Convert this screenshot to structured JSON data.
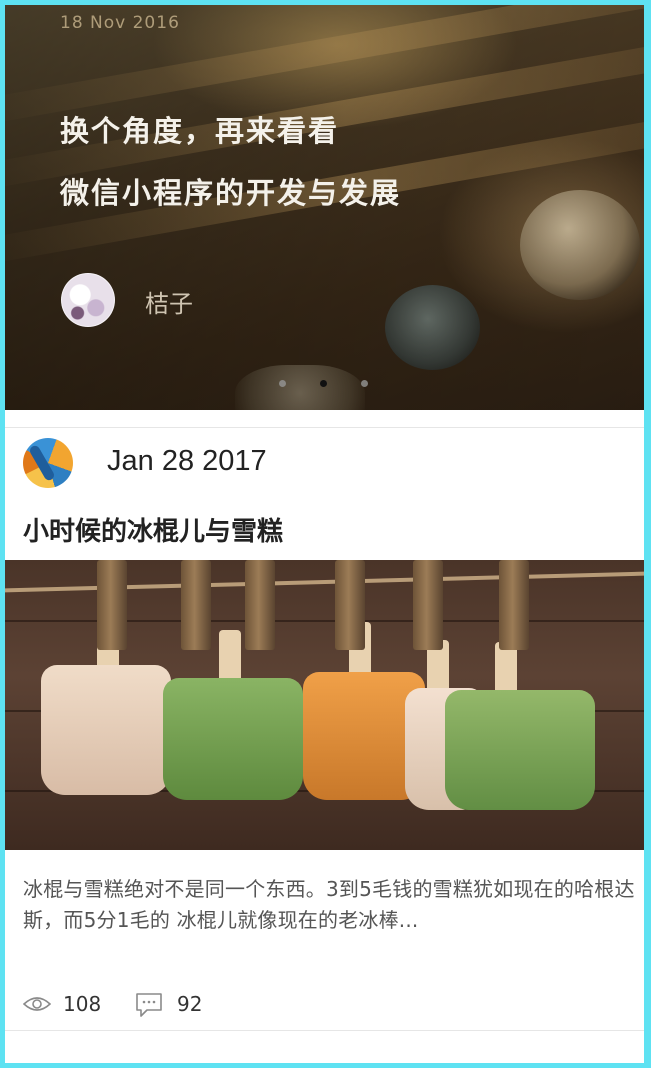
{
  "banner": {
    "date": "18 Nov 2016",
    "title_line1": "换个角度，再来看看",
    "title_line2": "微信小程序的开发与发展",
    "author": "桔子",
    "pagination": {
      "count": 3,
      "active_index": 2
    }
  },
  "card": {
    "date": "Jan 28 2017",
    "title": "小时候的冰棍儿与雪糕",
    "excerpt": "冰棍与雪糕绝对不是同一个东西。3到5毛钱的雪糕犹如现在的哈根达斯，而5分1毛的 冰棍儿就像现在的老冰棒...",
    "views": "108",
    "comments": "92",
    "icons": {
      "views": "eye-icon",
      "comments": "comment-icon"
    }
  },
  "colors": {
    "frame_border": "#5ee2f2",
    "text_primary": "#222222",
    "text_secondary": "#555555"
  }
}
